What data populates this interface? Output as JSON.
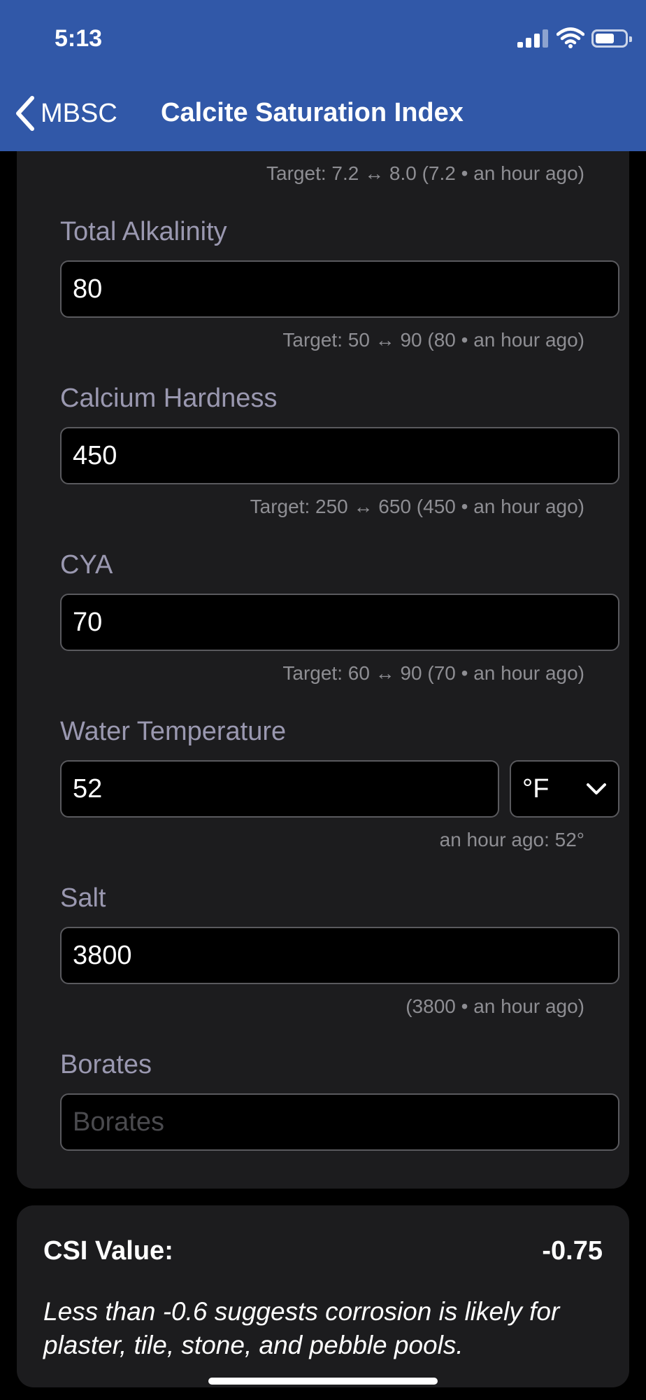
{
  "status_bar": {
    "time": "5:13"
  },
  "nav": {
    "back_label": "MBSC",
    "title": "Calcite Saturation Index"
  },
  "ph": {
    "hint": "Target: 7.2 ↔ 8.0   (7.2 • an hour ago)"
  },
  "fields": {
    "total_alkalinity": {
      "label": "Total Alkalinity",
      "value": "80",
      "hint": "Target: 50 ↔ 90   (80 • an hour ago)"
    },
    "calcium_hardness": {
      "label": "Calcium Hardness",
      "value": "450",
      "hint": "Target: 250 ↔ 650   (450 • an hour ago)"
    },
    "cya": {
      "label": "CYA",
      "value": "70",
      "hint": "Target: 60 ↔ 90   (70 • an hour ago)"
    },
    "water_temperature": {
      "label": "Water Temperature",
      "value": "52",
      "unit": "°F",
      "hint": "an hour ago: 52°"
    },
    "salt": {
      "label": "Salt",
      "value": "3800",
      "hint": "(3800 • an hour ago)"
    },
    "borates": {
      "label": "Borates",
      "placeholder": "Borates"
    }
  },
  "csi": {
    "label": "CSI Value:",
    "value": "-0.75",
    "note": "Less than -0.6 suggests corrosion is likely for plaster, tile, stone, and pebble pools."
  },
  "colors": {
    "header": "#3158a8",
    "card": "#1c1c1e",
    "label": "#9a98b0",
    "hint": "#8e8e93"
  }
}
